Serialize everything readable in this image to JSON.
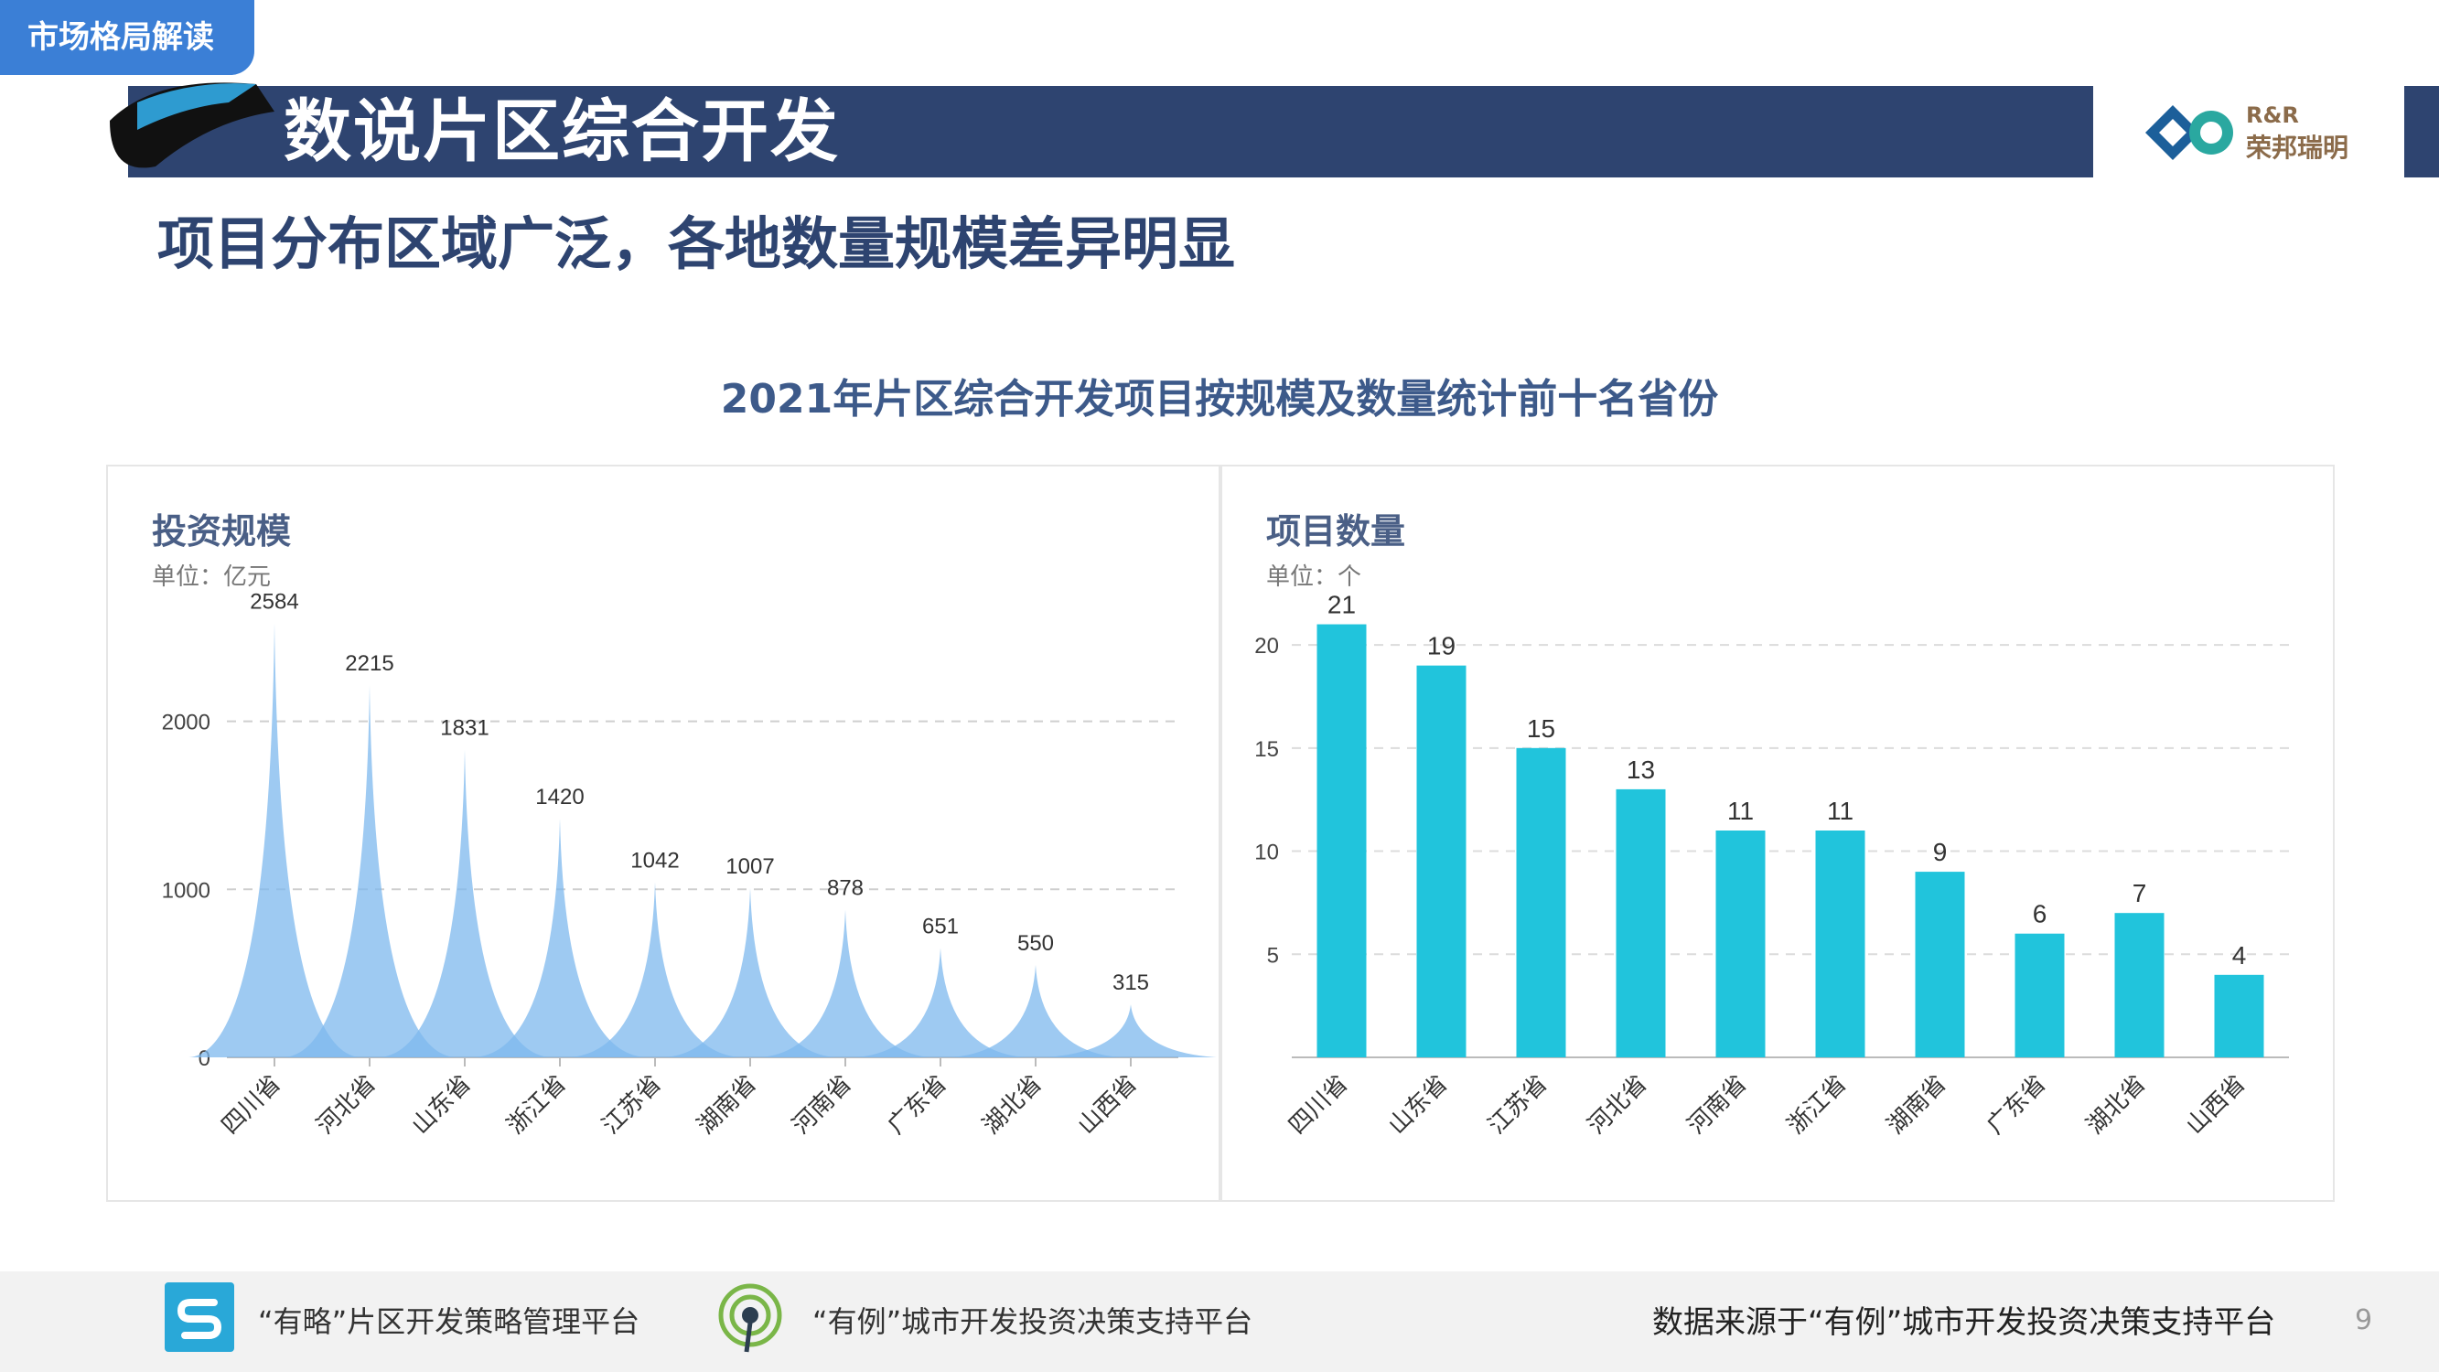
{
  "header": {
    "tag": "市场格局解读",
    "title": "数说片区综合开发",
    "subtitle": "项目分布区域广泛，各地数量规模差异明显",
    "logo_line1": "R&R",
    "logo_line2": "荣邦瑞明"
  },
  "chart_title": "2021年片区综合开发项目按规模及数量统计前十名省份",
  "chart_data": [
    {
      "type": "area",
      "title": "投资规模",
      "unit": "单位：亿元",
      "categories": [
        "四川省",
        "河北省",
        "山东省",
        "浙江省",
        "江苏省",
        "湖南省",
        "河南省",
        "广东省",
        "湖北省",
        "山西省"
      ],
      "values": [
        2584,
        2215,
        1831,
        1420,
        1042,
        1007,
        878,
        651,
        550,
        315
      ],
      "yticks": [
        0,
        1000,
        2000
      ],
      "ylim": [
        0,
        2700
      ],
      "grid": true,
      "color": "#7db8ee"
    },
    {
      "type": "bar",
      "title": "项目数量",
      "unit": "单位：个",
      "categories": [
        "四川省",
        "山东省",
        "江苏省",
        "河北省",
        "河南省",
        "浙江省",
        "湖南省",
        "广东省",
        "湖北省",
        "山西省"
      ],
      "values": [
        21,
        19,
        15,
        13,
        11,
        11,
        9,
        6,
        7,
        4
      ],
      "yticks": [
        5,
        10,
        15,
        20
      ],
      "ylim": [
        0,
        22
      ],
      "grid": true,
      "color": "#21c4dc"
    }
  ],
  "footer": {
    "platform1": "“有略”片区开发策略管理平台",
    "platform2": "“有例”城市开发投资决策支持平台",
    "source": "数据来源于“有例”城市开发投资决策支持平台",
    "page": "9"
  }
}
